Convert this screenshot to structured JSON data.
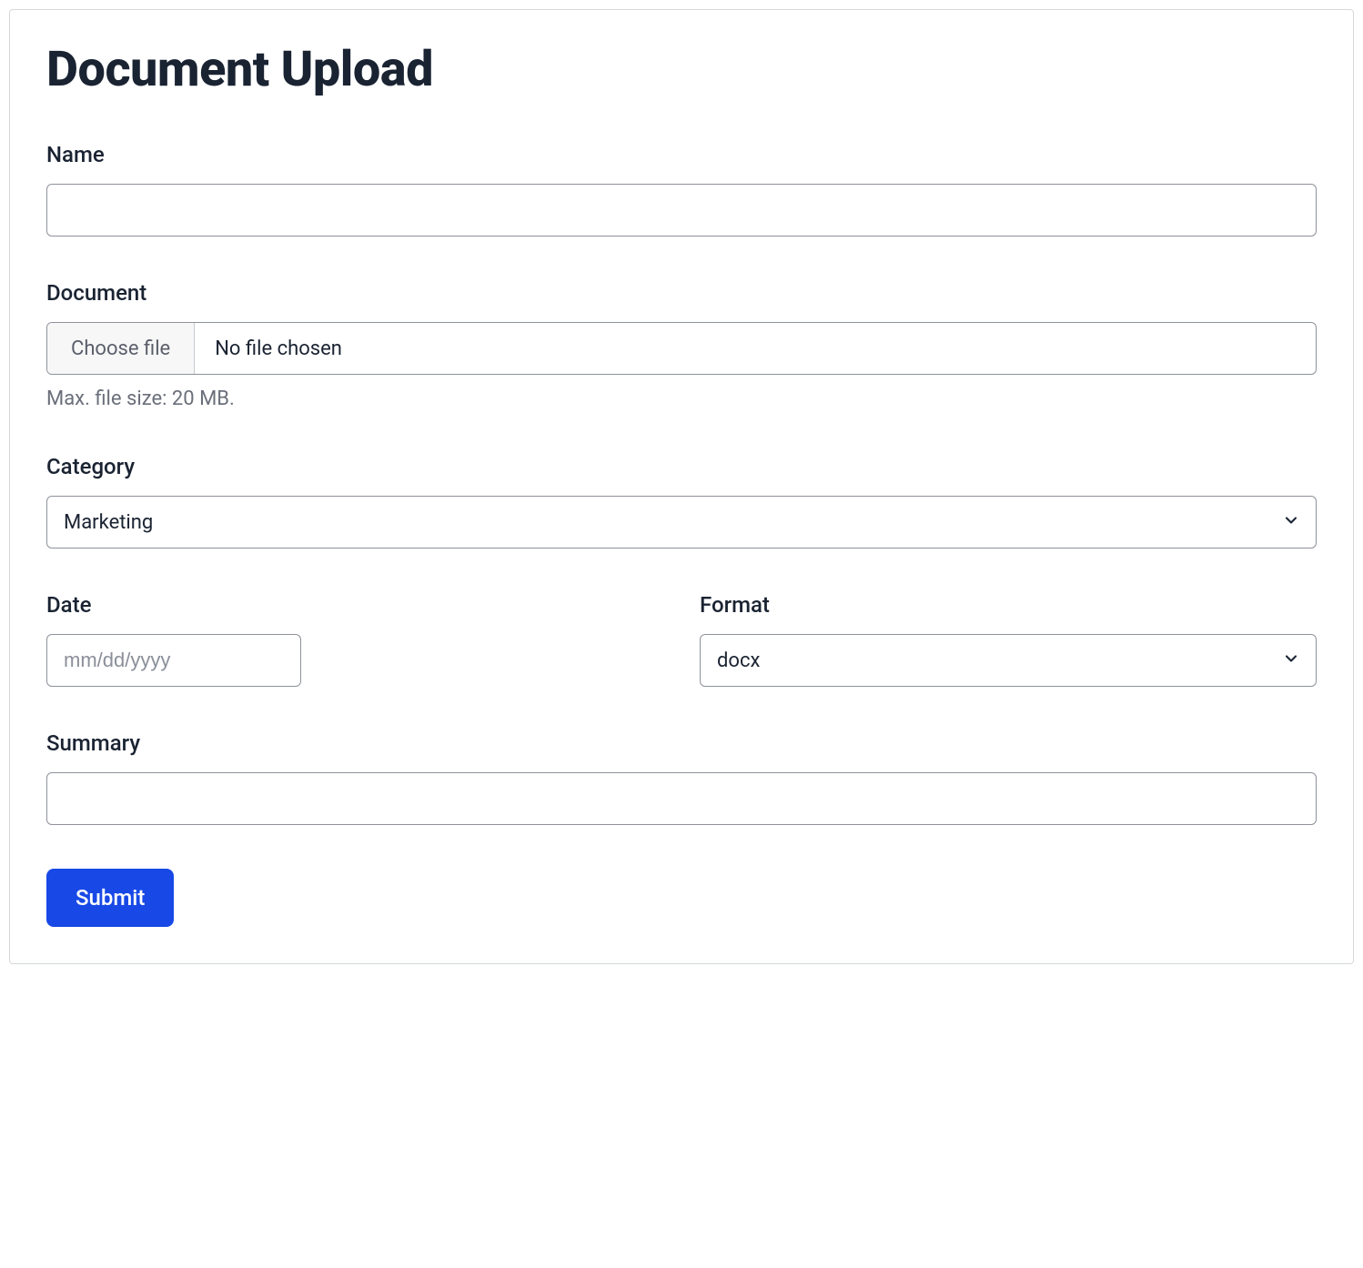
{
  "title": "Document Upload",
  "fields": {
    "name": {
      "label": "Name",
      "value": ""
    },
    "document": {
      "label": "Document",
      "button_label": "Choose file",
      "status": "No file chosen",
      "hint": "Max. file size: 20 MB."
    },
    "category": {
      "label": "Category",
      "value": "Marketing"
    },
    "date": {
      "label": "Date",
      "placeholder": "mm/dd/yyyy",
      "value": ""
    },
    "format": {
      "label": "Format",
      "value": "docx"
    },
    "summary": {
      "label": "Summary",
      "value": ""
    }
  },
  "submit_label": "Submit"
}
